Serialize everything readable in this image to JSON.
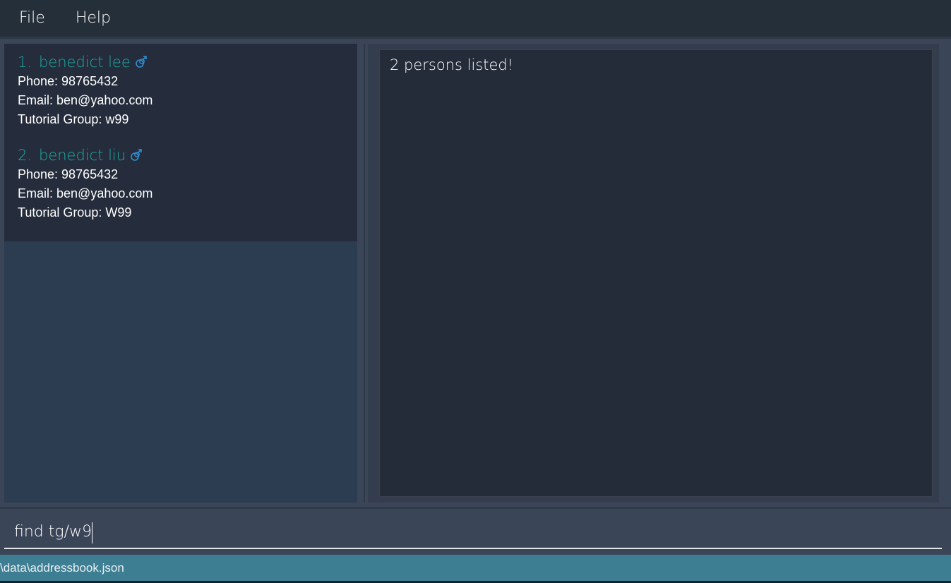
{
  "menu": {
    "file_label": "File",
    "help_label": "Help"
  },
  "persons": [
    {
      "index": "1.",
      "name": "benedict lee",
      "gender_icon": "male-icon",
      "phone": "Phone: 98765432",
      "email": "Email: ben@yahoo.com",
      "tutorial_group": "Tutorial Group: w99"
    },
    {
      "index": "2.",
      "name": "benedict liu",
      "gender_icon": "male-icon",
      "phone": "Phone: 98765432",
      "email": "Email: ben@yahoo.com",
      "tutorial_group": "Tutorial Group: W99"
    }
  ],
  "result": {
    "message": "2 persons listed!"
  },
  "command": {
    "value": "find tg/w9"
  },
  "status": {
    "file_path": "\\data\\addressbook.json"
  },
  "colors": {
    "accent_name": "#1fa8a0",
    "gender_icon": "#2f8fd6",
    "status_bar": "#3e7e93"
  }
}
